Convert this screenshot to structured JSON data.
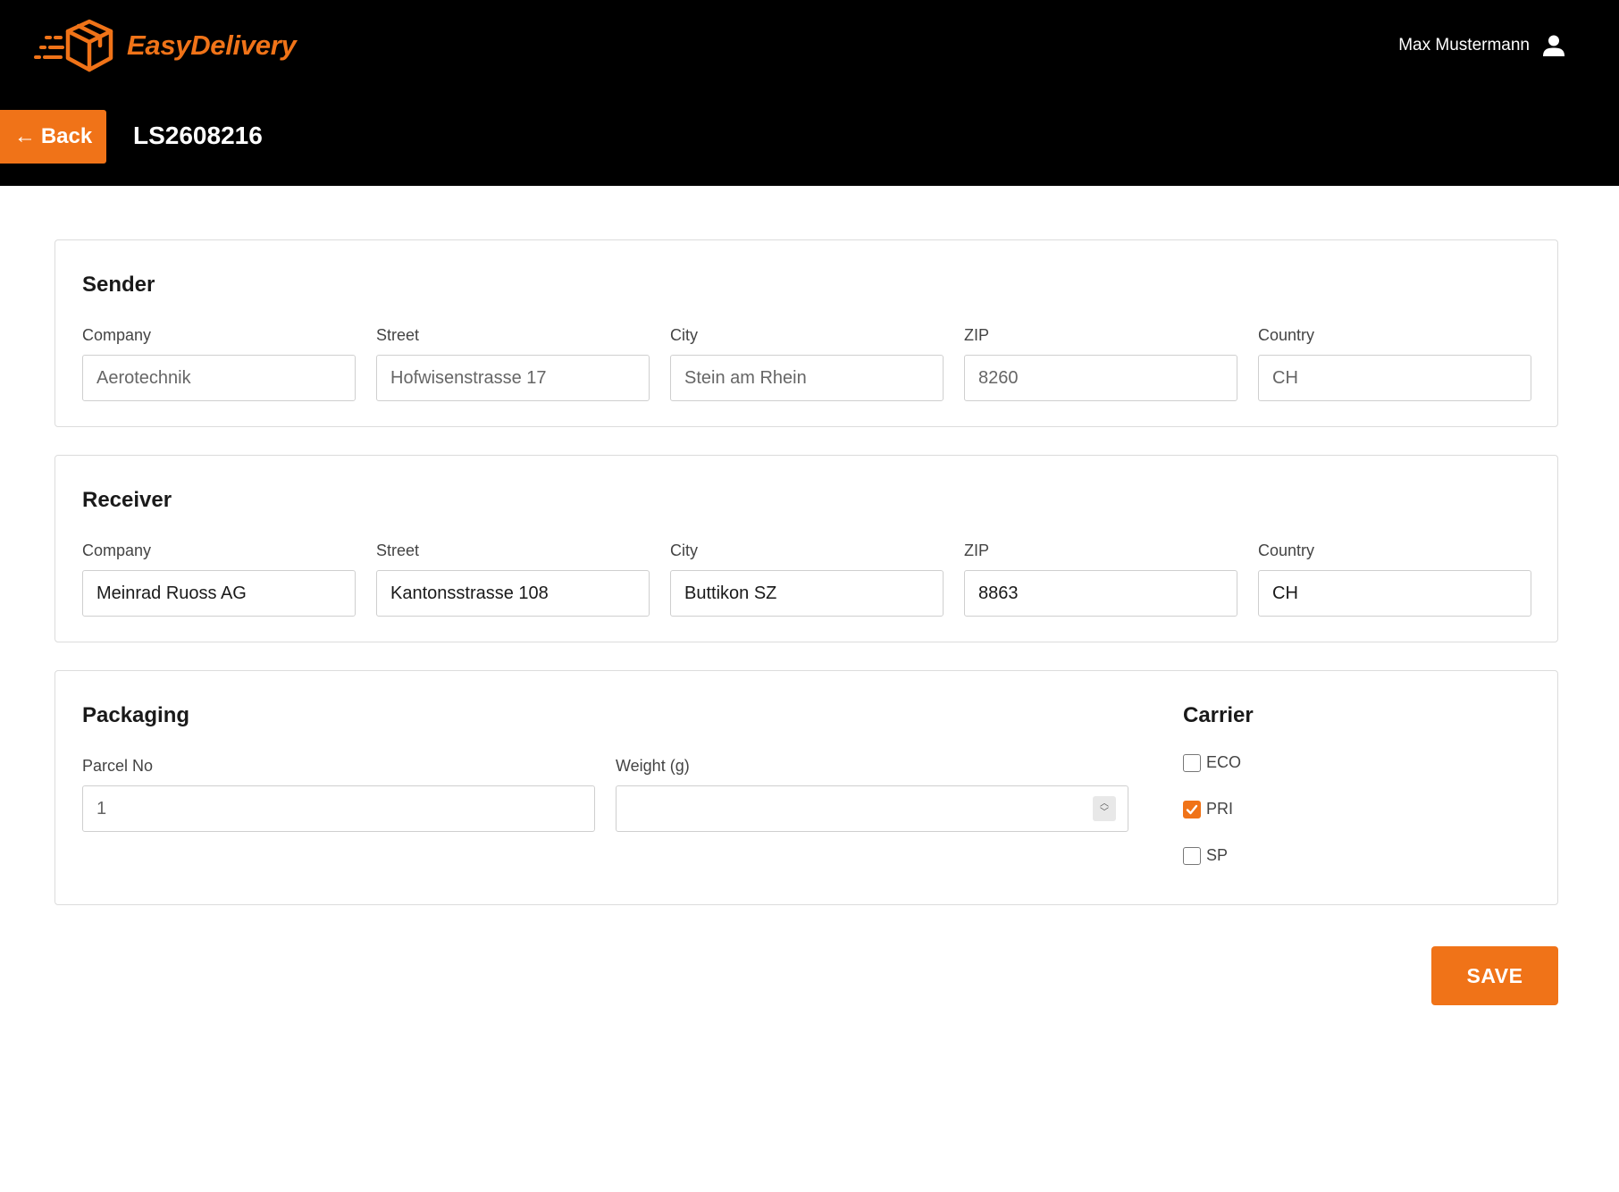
{
  "app": {
    "name": "EasyDelivery",
    "brand_color": "#f07318",
    "header_color": "#000000"
  },
  "user": {
    "name": "Max Mustermann",
    "icon": "user-icon"
  },
  "nav": {
    "back_label": "Back",
    "back_icon": "arrow-left-icon",
    "document_id": "LS2608216"
  },
  "sender": {
    "title": "Sender",
    "fields": [
      {
        "label": "Company",
        "value": "Aerotechnik"
      },
      {
        "label": "Street",
        "value": "Hofwisenstrasse 17"
      },
      {
        "label": "City",
        "value": "Stein am Rhein"
      },
      {
        "label": "ZIP",
        "value": "8260"
      },
      {
        "label": "Country",
        "value": "CH"
      }
    ]
  },
  "receiver": {
    "title": "Receiver",
    "fields": [
      {
        "label": "Company",
        "value": "Meinrad Ruoss AG"
      },
      {
        "label": "Street",
        "value": "Kantonsstrasse 108"
      },
      {
        "label": "City",
        "value": "Buttikon SZ"
      },
      {
        "label": "ZIP",
        "value": "8863"
      },
      {
        "label": "Country",
        "value": "CH"
      }
    ]
  },
  "packaging": {
    "title": "Packaging",
    "parcel_no": {
      "label": "Parcel No",
      "value": "1"
    },
    "weight": {
      "label": "Weight (g)",
      "value": ""
    }
  },
  "carrier": {
    "title": "Carrier",
    "options": [
      {
        "label": "ECO",
        "checked": false
      },
      {
        "label": "PRI",
        "checked": true
      },
      {
        "label": "SP",
        "checked": false
      }
    ]
  },
  "actions": {
    "save_label": "SAVE"
  }
}
